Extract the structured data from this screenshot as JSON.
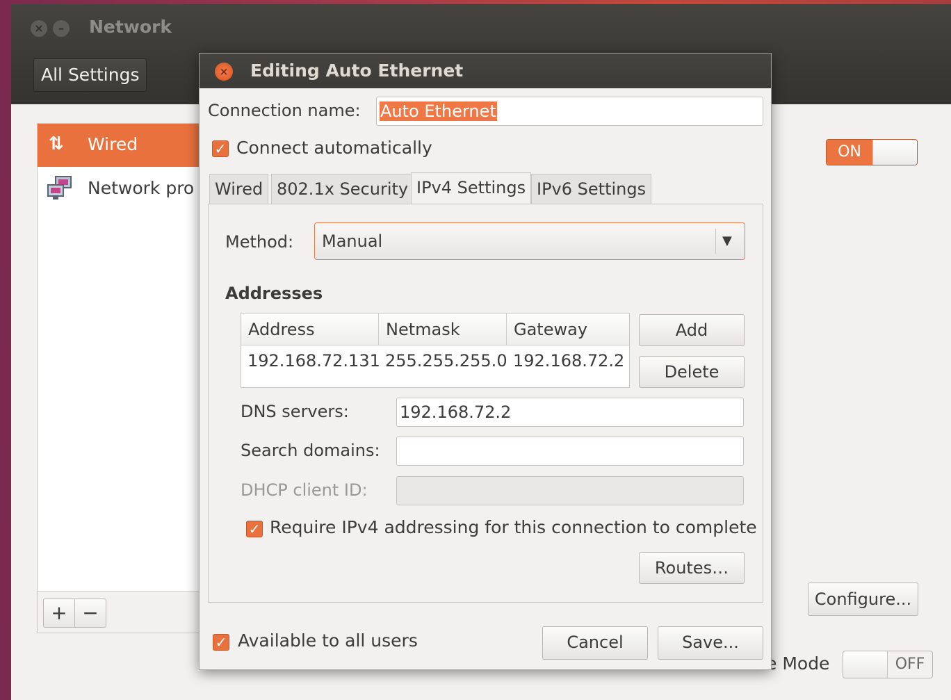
{
  "window": {
    "title": "Network",
    "all_settings_label": "All Settings"
  },
  "sidebar": {
    "items": [
      {
        "label": "Wired",
        "icon": "wired-arrows-icon"
      },
      {
        "label": "Network pro",
        "icon": "network-proxy-icon"
      }
    ],
    "add_label": "+",
    "remove_label": "−"
  },
  "wired_switch": {
    "state_label": "ON"
  },
  "configure_label": "Configure...",
  "airplane": {
    "label": "e Mode",
    "state_label": "OFF"
  },
  "dialog": {
    "title": "Editing Auto Ethernet",
    "connection_name_label": "Connection name:",
    "connection_name_value": "Auto Ethernet",
    "connect_automatically_label": "Connect automatically",
    "tabs": [
      "Wired",
      "802.1x Security",
      "IPv4 Settings",
      "IPv6 Settings"
    ],
    "active_tab": "IPv4 Settings",
    "method_label": "Method:",
    "method_value": "Manual",
    "addresses_label": "Addresses",
    "addresses_columns": [
      "Address",
      "Netmask",
      "Gateway"
    ],
    "addresses_rows": [
      [
        "192.168.72.131",
        "255.255.255.0",
        "192.168.72.2"
      ]
    ],
    "add_label": "Add",
    "delete_label": "Delete",
    "dns_label": "DNS servers:",
    "dns_value": "192.168.72.2",
    "search_domains_label": "Search domains:",
    "search_domains_value": "",
    "dhcp_client_id_label": "DHCP client ID:",
    "dhcp_client_id_value": "",
    "require_ipv4_label": "Require IPv4 addressing for this connection to complete",
    "routes_label": "Routes…",
    "available_all_users_label": "Available to all users",
    "cancel_label": "Cancel",
    "save_label": "Save..."
  },
  "colors": {
    "accent": "#e9713e",
    "titlebar": "#3c3b37",
    "window_bg": "#f2f1f0"
  }
}
